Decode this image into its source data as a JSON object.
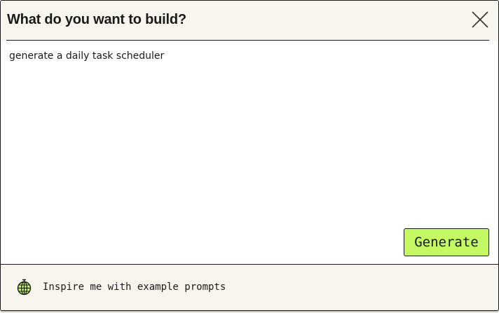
{
  "dialog": {
    "title": "What do you want to build?",
    "close_icon": "close-icon"
  },
  "prompt": {
    "value": "generate a daily task scheduler"
  },
  "actions": {
    "generate_label": "Generate"
  },
  "footer": {
    "inspire_label": "Inspire me with example prompts",
    "inspire_icon": "globe-icon"
  },
  "colors": {
    "accent": "#c5f964",
    "panel_background": "#f7f5ee",
    "text": "#1a1a1a"
  }
}
